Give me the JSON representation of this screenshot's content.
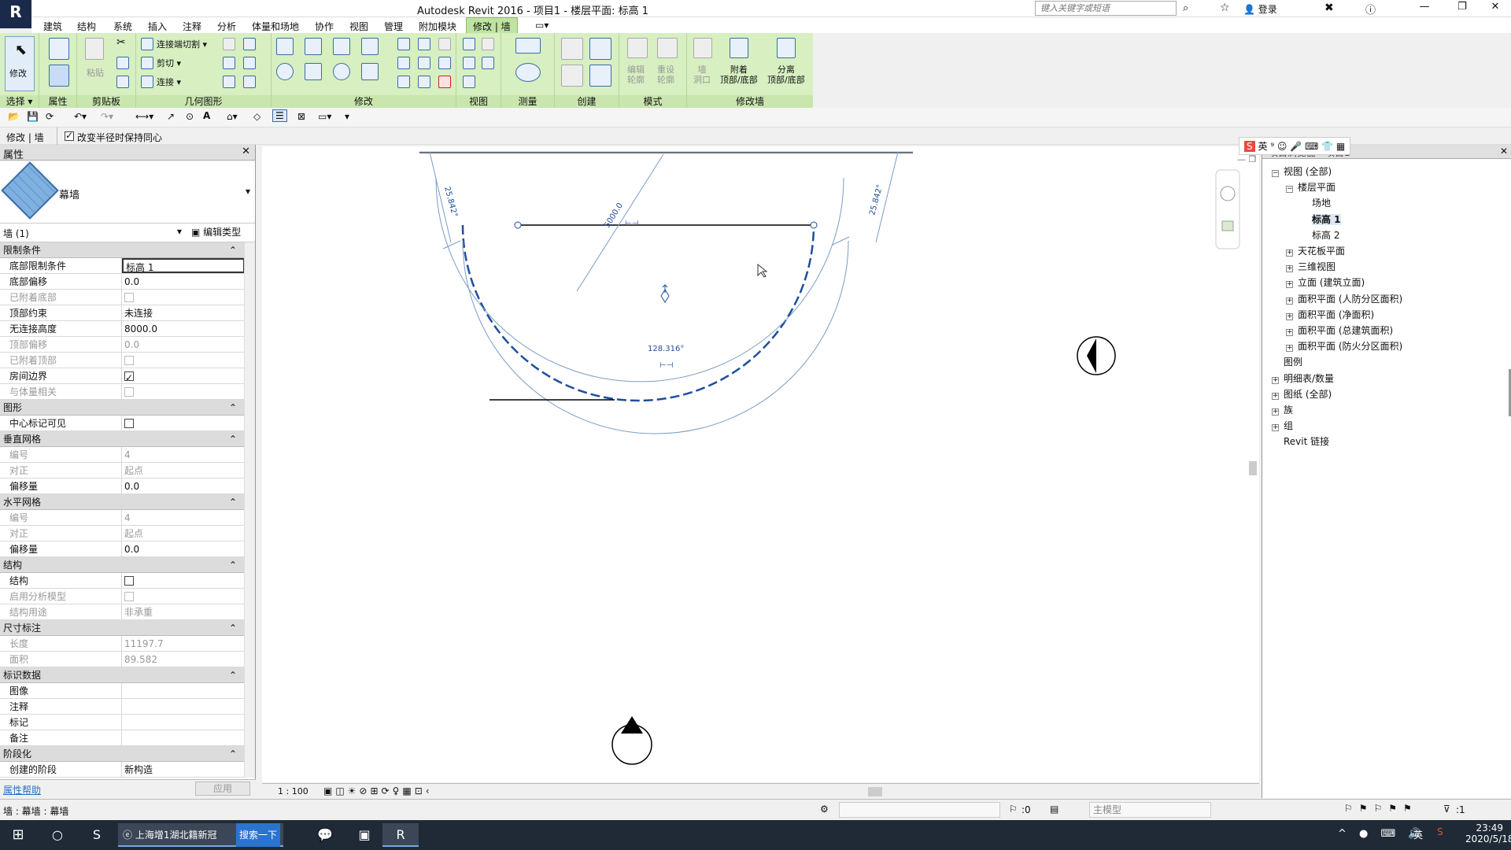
{
  "window": {
    "title": "Autodesk Revit 2016 -     项目1 - 楼层平面: 标高 1",
    "search_placeholder": "键入关键字或短语",
    "login": "登录",
    "app_letter": "R"
  },
  "menu": [
    "建筑",
    "结构",
    "系统",
    "插入",
    "注释",
    "分析",
    "体量和场地",
    "协作",
    "视图",
    "管理",
    "附加模块",
    "修改 | 墙"
  ],
  "ribbon": {
    "panels": [
      "选择 ▾",
      "属性",
      "剪贴板",
      "几何图形",
      "修改",
      "视图",
      "测量",
      "创建",
      "模式",
      "修改墙"
    ],
    "modify": "修改",
    "paste": "粘贴",
    "join_cut": "连接端切割 ▾",
    "cut": "剪切 ▾",
    "join": "连接 ▾",
    "edit_profile": "编辑\n轮廓",
    "reset_profile": "重设\n轮廓",
    "wall_opening": "墙\n洞口",
    "attach": "附着\n顶部/底部",
    "detach": "分离\n顶部/底部"
  },
  "options": {
    "context": "修改 | 墙",
    "keep_concentric": "改变半径时保持同心",
    "keep_checked": true
  },
  "properties": {
    "header": "属性",
    "type_name": "幕墙",
    "filter": "墙 (1)",
    "edit_type": "编辑类型",
    "sections": [
      {
        "title": "限制条件",
        "rows": [
          [
            "底部限制条件",
            "标高 1",
            "v",
            false
          ],
          [
            "底部偏移",
            "0.0",
            "v",
            false
          ],
          [
            "已附着底部",
            "",
            "cb-dis",
            true
          ],
          [
            "顶部约束",
            "未连接",
            "v",
            false
          ],
          [
            "无连接高度",
            "8000.0",
            "v",
            false
          ],
          [
            "顶部偏移",
            "0.0",
            "v",
            true
          ],
          [
            "已附着顶部",
            "",
            "cb-dis",
            true
          ],
          [
            "房间边界",
            "",
            "cb-on",
            false
          ],
          [
            "与体量相关",
            "",
            "cb-dis",
            true
          ]
        ]
      },
      {
        "title": "图形",
        "rows": [
          [
            "中心标记可见",
            "",
            "cb",
            false
          ]
        ]
      },
      {
        "title": "垂直网格",
        "rows": [
          [
            "编号",
            "4",
            "v",
            true
          ],
          [
            "对正",
            "起点",
            "v",
            true
          ],
          [
            "偏移量",
            "0.0",
            "v",
            false
          ]
        ]
      },
      {
        "title": "水平网格",
        "rows": [
          [
            "编号",
            "4",
            "v",
            true
          ],
          [
            "对正",
            "起点",
            "v",
            true
          ],
          [
            "偏移量",
            "0.0",
            "v",
            false
          ]
        ]
      },
      {
        "title": "结构",
        "rows": [
          [
            "结构",
            "",
            "cb",
            false
          ],
          [
            "启用分析模型",
            "",
            "cb-dis",
            true
          ],
          [
            "结构用途",
            "非承重",
            "v",
            true
          ]
        ]
      },
      {
        "title": "尺寸标注",
        "rows": [
          [
            "长度",
            "11197.7",
            "v",
            true
          ],
          [
            "面积",
            "89.582",
            "v",
            true
          ]
        ]
      },
      {
        "title": "标识数据",
        "rows": [
          [
            "图像",
            "",
            "v",
            false
          ],
          [
            "注释",
            "",
            "v",
            false
          ],
          [
            "标记",
            "",
            "v",
            false
          ],
          [
            "备注",
            "",
            "v",
            false
          ]
        ]
      },
      {
        "title": "阶段化",
        "rows": [
          [
            "创建的阶段",
            "新构造",
            "v",
            false
          ]
        ]
      }
    ],
    "help": "属性帮助",
    "apply": "应用"
  },
  "canvas": {
    "dim_radius": "5000.0",
    "dim_left_angle": "25.842°",
    "dim_right_angle": "25.842°",
    "dim_arc_angle": "128.316°",
    "scale": "1 : 100"
  },
  "browser": {
    "title": "项目浏览器 - 项目1",
    "nodes": [
      {
        "label": "视图 (全部)",
        "level": 0,
        "exp": "−"
      },
      {
        "label": "楼层平面",
        "level": 1,
        "exp": "−"
      },
      {
        "label": "场地",
        "level": 2,
        "exp": ""
      },
      {
        "label": "标高 1",
        "level": 2,
        "exp": "",
        "bold": true
      },
      {
        "label": "标高 2",
        "level": 2,
        "exp": ""
      },
      {
        "label": "天花板平面",
        "level": 1,
        "exp": "+"
      },
      {
        "label": "三维视图",
        "level": 1,
        "exp": "+"
      },
      {
        "label": "立面 (建筑立面)",
        "level": 1,
        "exp": "+"
      },
      {
        "label": "面积平面 (人防分区面积)",
        "level": 1,
        "exp": "+"
      },
      {
        "label": "面积平面 (净面积)",
        "level": 1,
        "exp": "+"
      },
      {
        "label": "面积平面 (总建筑面积)",
        "level": 1,
        "exp": "+"
      },
      {
        "label": "面积平面 (防火分区面积)",
        "level": 1,
        "exp": "+"
      },
      {
        "label": "图例",
        "level": 0,
        "exp": ""
      },
      {
        "label": "明细表/数量",
        "level": 0,
        "exp": "+"
      },
      {
        "label": "图纸 (全部)",
        "level": 0,
        "exp": "+"
      },
      {
        "label": "族",
        "level": 0,
        "exp": "+"
      },
      {
        "label": "组",
        "level": 0,
        "exp": "+"
      },
      {
        "label": "Revit 链接",
        "level": 0,
        "exp": ""
      }
    ]
  },
  "status": {
    "text": "墙 : 幕墙 : 幕墙",
    "model": "主模型",
    "counter": ":0",
    "filter_count": ":1"
  },
  "taskbar": {
    "browser_tab": "上海增1湖北籍新冠",
    "search_btn": "搜索一下",
    "time": "23:49",
    "date": "2020/5/18",
    "ime": "英"
  }
}
